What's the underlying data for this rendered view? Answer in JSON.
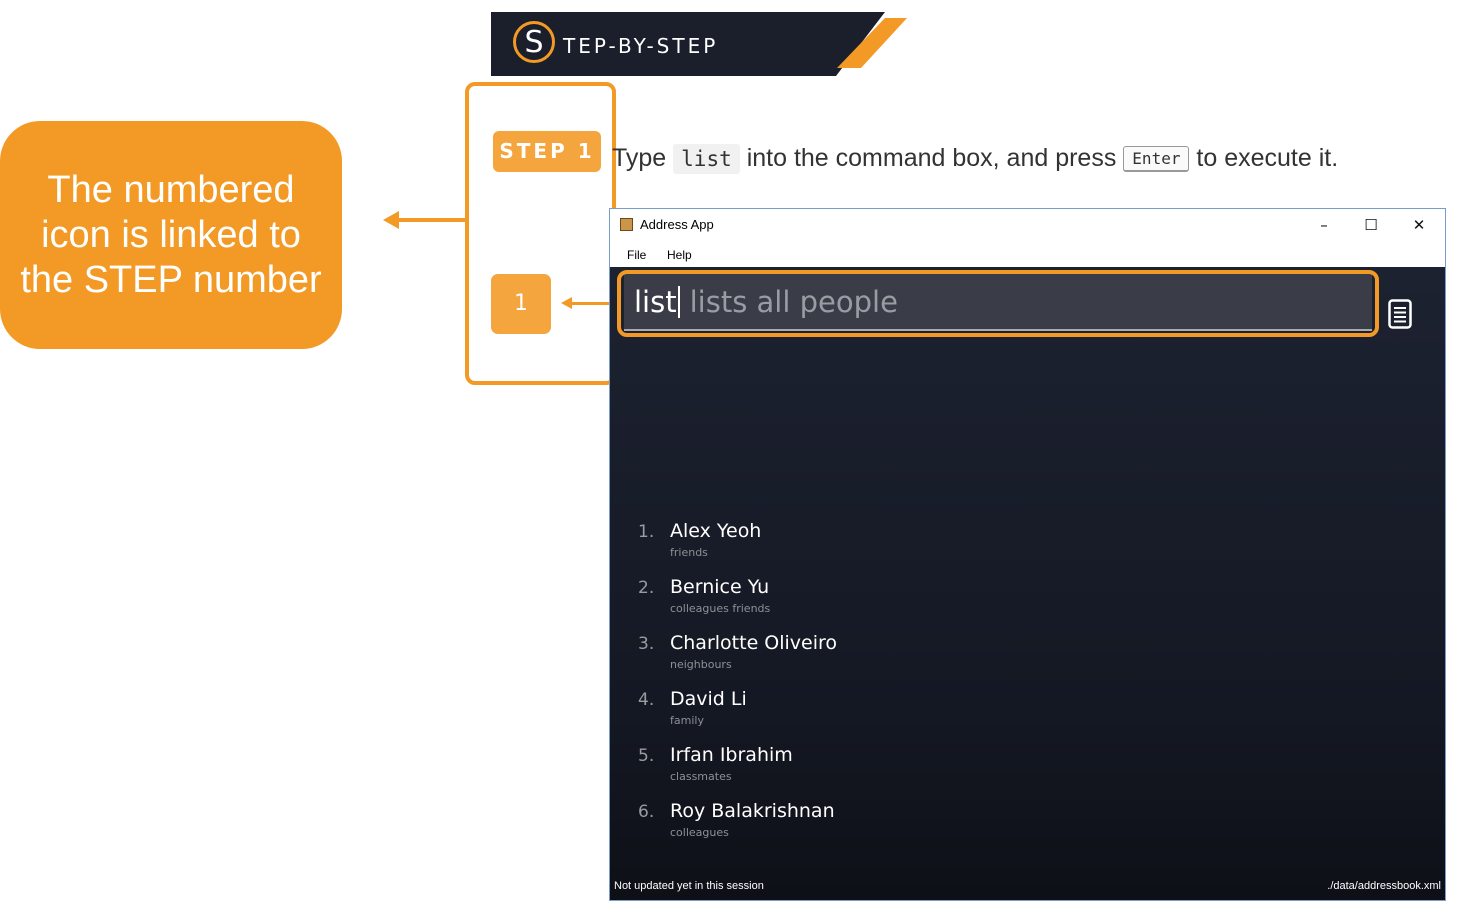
{
  "banner": {
    "letter": "S",
    "title": "TEP-BY-STEP",
    "colors": {
      "dark": "#1b1f2b",
      "accent": "#f29a25"
    }
  },
  "callout": {
    "text": "The numbered icon is linked to the STEP number"
  },
  "step": {
    "badge": "STEP 1",
    "number": "1"
  },
  "instruction": {
    "prefix": "Type",
    "code": "list",
    "middle": "into the command box, and press",
    "key": "Enter",
    "suffix": "to execute it."
  },
  "app": {
    "title": "Address App",
    "window_buttons": {
      "minimize": "–",
      "maximize": "☐",
      "close": "✕"
    },
    "menu": [
      "File",
      "Help"
    ],
    "command": {
      "typed": "list",
      "hint": "lists all people"
    },
    "result_icon": "document-list-icon",
    "people": [
      {
        "index": "1.",
        "name": "Alex Yeoh",
        "tags": "friends"
      },
      {
        "index": "2.",
        "name": "Bernice Yu",
        "tags": "colleagues  friends"
      },
      {
        "index": "3.",
        "name": "Charlotte Oliveiro",
        "tags": "neighbours"
      },
      {
        "index": "4.",
        "name": "David Li",
        "tags": "family"
      },
      {
        "index": "5.",
        "name": "Irfan Ibrahim",
        "tags": "classmates"
      },
      {
        "index": "6.",
        "name": "Roy Balakrishnan",
        "tags": "colleagues"
      }
    ],
    "status": {
      "left": "Not updated yet in this session",
      "right": "./data/addressbook.xml"
    }
  }
}
